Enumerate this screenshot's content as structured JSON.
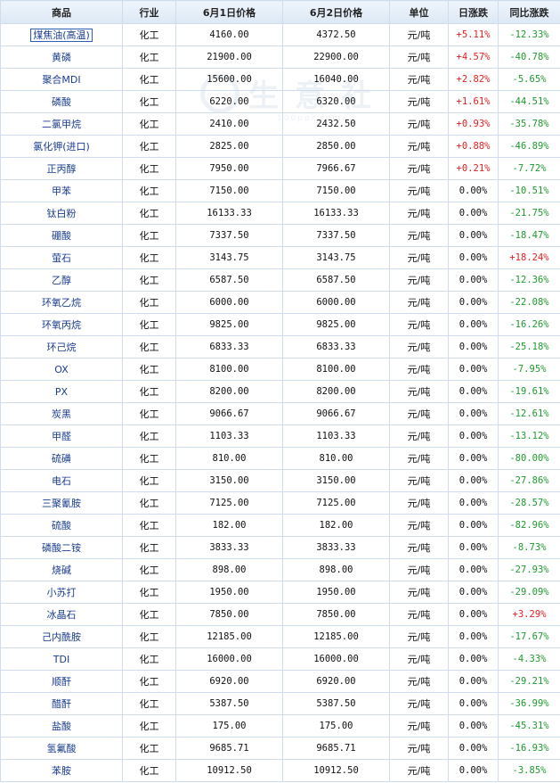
{
  "headers": {
    "product": "商品",
    "industry": "行业",
    "price_june1": "6月1日价格",
    "price_june2": "6月2日价格",
    "unit": "单位",
    "daily_change": "日涨跌",
    "yoy_change": "同比涨跌"
  },
  "watermark": {
    "text": "生意社",
    "url": "100ppi.com"
  },
  "colors": {
    "up": "#e02020",
    "down": "#1e9a2e",
    "link": "#1a3d8f",
    "border": "#cfdceb"
  },
  "rows": [
    {
      "name": "煤焦油(高温)",
      "industry": "化工",
      "p1": "4160.00",
      "p2": "4372.50",
      "unit": "元/吨",
      "daily": "+5.11%",
      "yoy": "-12.33%"
    },
    {
      "name": "黄磷",
      "industry": "化工",
      "p1": "21900.00",
      "p2": "22900.00",
      "unit": "元/吨",
      "daily": "+4.57%",
      "yoy": "-40.78%"
    },
    {
      "name": "聚合MDI",
      "industry": "化工",
      "p1": "15600.00",
      "p2": "16040.00",
      "unit": "元/吨",
      "daily": "+2.82%",
      "yoy": "-5.65%"
    },
    {
      "name": "磷酸",
      "industry": "化工",
      "p1": "6220.00",
      "p2": "6320.00",
      "unit": "元/吨",
      "daily": "+1.61%",
      "yoy": "-44.51%"
    },
    {
      "name": "二氯甲烷",
      "industry": "化工",
      "p1": "2410.00",
      "p2": "2432.50",
      "unit": "元/吨",
      "daily": "+0.93%",
      "yoy": "-35.78%"
    },
    {
      "name": "氯化钾(进口)",
      "industry": "化工",
      "p1": "2825.00",
      "p2": "2850.00",
      "unit": "元/吨",
      "daily": "+0.88%",
      "yoy": "-46.89%"
    },
    {
      "name": "正丙醇",
      "industry": "化工",
      "p1": "7950.00",
      "p2": "7966.67",
      "unit": "元/吨",
      "daily": "+0.21%",
      "yoy": "-7.72%"
    },
    {
      "name": "甲苯",
      "industry": "化工",
      "p1": "7150.00",
      "p2": "7150.00",
      "unit": "元/吨",
      "daily": "0.00%",
      "yoy": "-10.51%"
    },
    {
      "name": "钛白粉",
      "industry": "化工",
      "p1": "16133.33",
      "p2": "16133.33",
      "unit": "元/吨",
      "daily": "0.00%",
      "yoy": "-21.75%"
    },
    {
      "name": "硼酸",
      "industry": "化工",
      "p1": "7337.50",
      "p2": "7337.50",
      "unit": "元/吨",
      "daily": "0.00%",
      "yoy": "-18.47%"
    },
    {
      "name": "萤石",
      "industry": "化工",
      "p1": "3143.75",
      "p2": "3143.75",
      "unit": "元/吨",
      "daily": "0.00%",
      "yoy": "+18.24%"
    },
    {
      "name": "乙醇",
      "industry": "化工",
      "p1": "6587.50",
      "p2": "6587.50",
      "unit": "元/吨",
      "daily": "0.00%",
      "yoy": "-12.36%"
    },
    {
      "name": "环氧乙烷",
      "industry": "化工",
      "p1": "6000.00",
      "p2": "6000.00",
      "unit": "元/吨",
      "daily": "0.00%",
      "yoy": "-22.08%"
    },
    {
      "name": "环氧丙烷",
      "industry": "化工",
      "p1": "9825.00",
      "p2": "9825.00",
      "unit": "元/吨",
      "daily": "0.00%",
      "yoy": "-16.26%"
    },
    {
      "name": "环己烷",
      "industry": "化工",
      "p1": "6833.33",
      "p2": "6833.33",
      "unit": "元/吨",
      "daily": "0.00%",
      "yoy": "-25.18%"
    },
    {
      "name": "OX",
      "industry": "化工",
      "p1": "8100.00",
      "p2": "8100.00",
      "unit": "元/吨",
      "daily": "0.00%",
      "yoy": "-7.95%"
    },
    {
      "name": "PX",
      "industry": "化工",
      "p1": "8200.00",
      "p2": "8200.00",
      "unit": "元/吨",
      "daily": "0.00%",
      "yoy": "-19.61%"
    },
    {
      "name": "炭黑",
      "industry": "化工",
      "p1": "9066.67",
      "p2": "9066.67",
      "unit": "元/吨",
      "daily": "0.00%",
      "yoy": "-12.61%"
    },
    {
      "name": "甲醛",
      "industry": "化工",
      "p1": "1103.33",
      "p2": "1103.33",
      "unit": "元/吨",
      "daily": "0.00%",
      "yoy": "-13.12%"
    },
    {
      "name": "硫磺",
      "industry": "化工",
      "p1": "810.00",
      "p2": "810.00",
      "unit": "元/吨",
      "daily": "0.00%",
      "yoy": "-80.00%"
    },
    {
      "name": "电石",
      "industry": "化工",
      "p1": "3150.00",
      "p2": "3150.00",
      "unit": "元/吨",
      "daily": "0.00%",
      "yoy": "-27.86%"
    },
    {
      "name": "三聚氰胺",
      "industry": "化工",
      "p1": "7125.00",
      "p2": "7125.00",
      "unit": "元/吨",
      "daily": "0.00%",
      "yoy": "-28.57%"
    },
    {
      "name": "硫酸",
      "industry": "化工",
      "p1": "182.00",
      "p2": "182.00",
      "unit": "元/吨",
      "daily": "0.00%",
      "yoy": "-82.96%"
    },
    {
      "name": "磷酸二铵",
      "industry": "化工",
      "p1": "3833.33",
      "p2": "3833.33",
      "unit": "元/吨",
      "daily": "0.00%",
      "yoy": "-8.73%"
    },
    {
      "name": "烧碱",
      "industry": "化工",
      "p1": "898.00",
      "p2": "898.00",
      "unit": "元/吨",
      "daily": "0.00%",
      "yoy": "-27.93%"
    },
    {
      "name": "小苏打",
      "industry": "化工",
      "p1": "1950.00",
      "p2": "1950.00",
      "unit": "元/吨",
      "daily": "0.00%",
      "yoy": "-29.09%"
    },
    {
      "name": "冰晶石",
      "industry": "化工",
      "p1": "7850.00",
      "p2": "7850.00",
      "unit": "元/吨",
      "daily": "0.00%",
      "yoy": "+3.29%"
    },
    {
      "name": "己内酰胺",
      "industry": "化工",
      "p1": "12185.00",
      "p2": "12185.00",
      "unit": "元/吨",
      "daily": "0.00%",
      "yoy": "-17.67%"
    },
    {
      "name": "TDI",
      "industry": "化工",
      "p1": "16000.00",
      "p2": "16000.00",
      "unit": "元/吨",
      "daily": "0.00%",
      "yoy": "-4.33%"
    },
    {
      "name": "顺酐",
      "industry": "化工",
      "p1": "6920.00",
      "p2": "6920.00",
      "unit": "元/吨",
      "daily": "0.00%",
      "yoy": "-29.21%"
    },
    {
      "name": "醋酐",
      "industry": "化工",
      "p1": "5387.50",
      "p2": "5387.50",
      "unit": "元/吨",
      "daily": "0.00%",
      "yoy": "-36.99%"
    },
    {
      "name": "盐酸",
      "industry": "化工",
      "p1": "175.00",
      "p2": "175.00",
      "unit": "元/吨",
      "daily": "0.00%",
      "yoy": "-45.31%"
    },
    {
      "name": "氢氟酸",
      "industry": "化工",
      "p1": "9685.71",
      "p2": "9685.71",
      "unit": "元/吨",
      "daily": "0.00%",
      "yoy": "-16.93%"
    },
    {
      "name": "苯胺",
      "industry": "化工",
      "p1": "10912.50",
      "p2": "10912.50",
      "unit": "元/吨",
      "daily": "0.00%",
      "yoy": "-3.85%"
    }
  ]
}
